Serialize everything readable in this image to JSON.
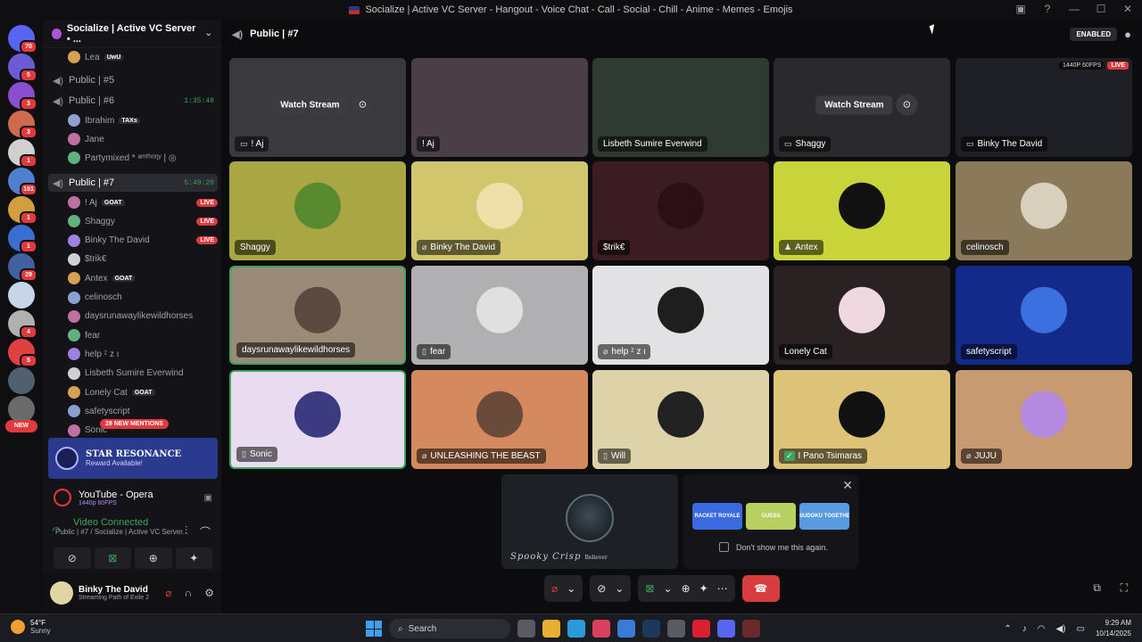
{
  "window": {
    "title": "Socialize | Active VC Server - Hangout - Voice Chat - Call - Social - Chill - Anime - Memes - Emojis"
  },
  "rail": {
    "servers": [
      {
        "badge": "70",
        "color": "#5865f2"
      },
      {
        "badge": "5",
        "color": "#6b5bd6"
      },
      {
        "badge": "3",
        "color": "#8a4fd0"
      },
      {
        "badge": "3",
        "color": "#d06a4f"
      },
      {
        "badge": "1",
        "color": "#d0d0d0"
      },
      {
        "badge": "191",
        "color": "#4f7fd0"
      },
      {
        "badge": "1",
        "color": "#d0a040"
      },
      {
        "badge": "1",
        "color": "#3a6ed0"
      },
      {
        "badge": "29",
        "color": "#4060a0"
      },
      {
        "badge": "",
        "color": "#c8d4e8"
      },
      {
        "badge": "4",
        "color": "#b0b0b0"
      },
      {
        "badge": "5",
        "color": "#e04040"
      },
      {
        "badge": "",
        "color": "#506070"
      },
      {
        "badge": "",
        "color": "#6a6a6a"
      }
    ],
    "new_label": "NEW"
  },
  "sidebar": {
    "server_name": "Socialize | Active VC Server • ...",
    "top_user": {
      "name": "Lea",
      "tag": "UwU"
    },
    "channels": [
      {
        "name": "Public | #5",
        "time": ""
      },
      {
        "name": "Public | #6",
        "time": "1:35:48"
      },
      {
        "name": "Public | #7",
        "time": "5:49:20"
      }
    ],
    "channel6_users": [
      {
        "name": "Ibrahim",
        "tag": "TAXs"
      },
      {
        "name": "Jane",
        "tag": ""
      },
      {
        "name": "Partymixed * ᵃᵐᵗʰᵒᵑʸ | ◎",
        "tag": ""
      }
    ],
    "channel7_users": [
      {
        "name": "! Aj",
        "tag": "GOAT",
        "live": "LIVE"
      },
      {
        "name": "Shaggy",
        "tag": "",
        "live": "LIVE"
      },
      {
        "name": "Binky The David",
        "tag": "",
        "live": "LIVE"
      },
      {
        "name": "$trik€",
        "tag": "",
        "live": ""
      },
      {
        "name": "Antex",
        "tag": "GOAT",
        "live": ""
      },
      {
        "name": "celinosch",
        "tag": "",
        "live": ""
      },
      {
        "name": "daysrunawaylikewildhorses",
        "tag": "",
        "live": ""
      },
      {
        "name": "fear",
        "tag": "",
        "live": ""
      },
      {
        "name": "help ᶻ z ι",
        "tag": "",
        "live": ""
      },
      {
        "name": "Lisbeth Sumire Everwind",
        "tag": "",
        "live": ""
      },
      {
        "name": "Lonely Cat",
        "tag": "GOAT",
        "live": ""
      },
      {
        "name": "safetyscript",
        "tag": "",
        "live": ""
      },
      {
        "name": "Sonic",
        "tag": "",
        "live": ""
      }
    ],
    "mentions": "29 NEW MENTIONS",
    "promo": {
      "title": "STAR RESONANCE",
      "subtitle": "Reward Available!"
    },
    "now_playing": {
      "name": "YouTube - Opera",
      "sub": "1440p 60FPS"
    },
    "voice": {
      "status": "Video Connected",
      "channel": "Public | #7 / Socialize | Active VC Server..."
    },
    "user": {
      "name": "Binky The David",
      "status": "Streaming Path of Exile 2"
    }
  },
  "main": {
    "channel": "Public | #7",
    "enabled": "ENABLED",
    "watch_stream": "Watch Stream",
    "tiles": [
      {
        "label": "! Aj",
        "bg": "#3a3a3e",
        "avatar": "",
        "watch": true,
        "icon": "screen"
      },
      {
        "label": "! Aj",
        "bg": "#4a3f46",
        "avatar": "",
        "watch": false,
        "icon": ""
      },
      {
        "label": "Lisbeth Sumire Everwind",
        "bg": "#2f3a33",
        "avatar": "",
        "watch": false,
        "icon": ""
      },
      {
        "label": "Shaggy",
        "bg": "#2a2a2e",
        "avatar": "",
        "watch": true,
        "icon": "screen"
      },
      {
        "label": "Binky The David",
        "bg": "#1f2025",
        "avatar": "",
        "watch": false,
        "icon": "screen",
        "fps": "1440P 60FPS",
        "live": "LIVE"
      },
      {
        "label": "Shaggy",
        "bg": "#a9a644",
        "avatar": "#5a8a30",
        "icon": ""
      },
      {
        "label": "Binky The David",
        "bg": "#d1c66b",
        "avatar": "#eee0a8",
        "icon": "mute"
      },
      {
        "label": "$trik€",
        "bg": "#3a1c22",
        "avatar": "#2a1016",
        "icon": ""
      },
      {
        "label": "Antex",
        "bg": "#c9d43a",
        "avatar": "#111111",
        "icon": "user"
      },
      {
        "label": "celinosch",
        "bg": "#8a7a5a",
        "avatar": "#d8d0bc",
        "icon": ""
      },
      {
        "label": "daysrunawaylikewildhorses",
        "bg": "#9a8a78",
        "avatar": "#5a4a40",
        "icon": "",
        "selected": true
      },
      {
        "label": "fear",
        "bg": "#b0b0b2",
        "avatar": "#e0e0e0",
        "icon": "phone"
      },
      {
        "label": "help ᶻ z ι",
        "bg": "#e2e2e4",
        "avatar": "#1e1e1e",
        "icon": "mute"
      },
      {
        "label": "Lonely Cat",
        "bg": "#2a2123",
        "avatar": "#f0d8e0",
        "icon": ""
      },
      {
        "label": "safetyscript",
        "bg": "#142a8a",
        "avatar": "#3a70e0",
        "icon": ""
      },
      {
        "label": "Sonic",
        "bg": "#e9dcf0",
        "avatar": "#3c3a80",
        "icon": "phone",
        "selected": true
      },
      {
        "label": "UNLEASHING THE BEAST",
        "bg": "#d48a5e",
        "avatar": "#6a4a3a",
        "icon": "mute"
      },
      {
        "label": "Will",
        "bg": "#ddd2a8",
        "avatar": "#222222",
        "icon": "phone"
      },
      {
        "label": "I Pano Tsimaras",
        "bg": "#dcc378",
        "avatar": "#111111",
        "icon": "check"
      },
      {
        "label": "JUJU",
        "bg": "#c89a72",
        "avatar": "#b48ae0",
        "icon": "mute"
      }
    ],
    "pip": {
      "caption": "Spooky Crisp",
      "small": "Believer"
    },
    "activities": {
      "games": [
        {
          "name": "RACKET ROYALE",
          "color": "#3a6ae0"
        },
        {
          "name": "GUESS",
          "color": "#b8d060"
        },
        {
          "name": "SUDOKU TOGETHER",
          "color": "#5a9ae0"
        }
      ],
      "dont_show": "Don't show me this again."
    }
  },
  "taskbar": {
    "temp": "54°F",
    "weather": "Sunny",
    "search": "Search",
    "time": "9:29 AM",
    "date": "10/14/2025"
  }
}
